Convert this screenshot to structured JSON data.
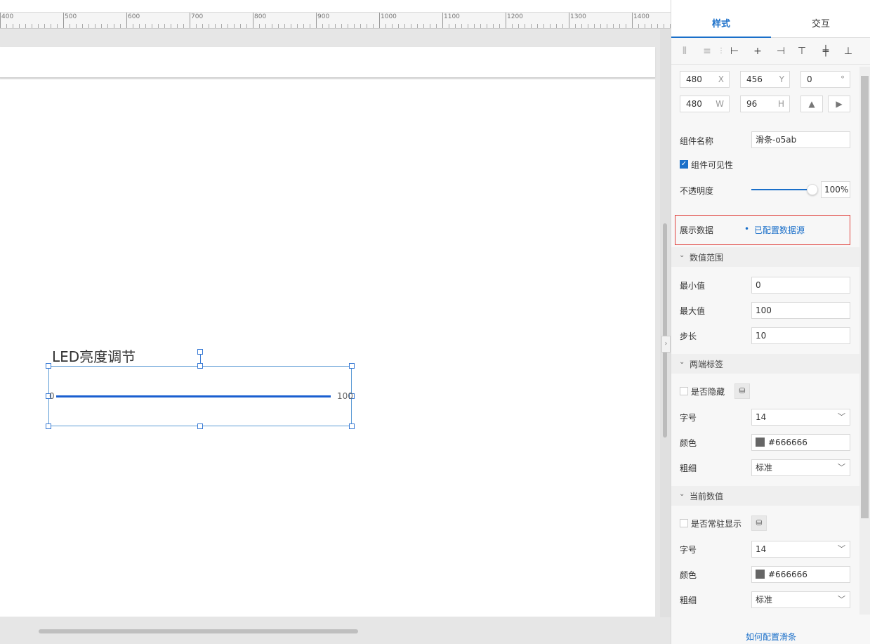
{
  "ruler": {
    "ticks": [
      "400",
      "500",
      "600",
      "700",
      "800",
      "900",
      "1000",
      "1100",
      "1200",
      "1300",
      "1400"
    ]
  },
  "canvas": {
    "widget_title": "LED亮度调节",
    "slider": {
      "min_label": "0",
      "max_label": "100"
    }
  },
  "panel": {
    "tabs": [
      {
        "label": "样式",
        "active": true
      },
      {
        "label": "交互",
        "active": false
      }
    ],
    "position": {
      "x": {
        "value": "480",
        "unit": "X"
      },
      "y": {
        "value": "456",
        "unit": "Y"
      },
      "rotate": {
        "value": "0",
        "unit": "°"
      },
      "w": {
        "value": "480",
        "unit": "W"
      },
      "h": {
        "value": "96",
        "unit": "H"
      }
    },
    "component_name": {
      "label": "组件名称",
      "value": "滑条-o5ab"
    },
    "visibility": {
      "label": "组件可见性",
      "checked": true
    },
    "opacity": {
      "label": "不透明度",
      "value": "100%",
      "level": 1.0
    },
    "data_source": {
      "label": "展示数据",
      "status": "已配置数据源"
    },
    "range_section": {
      "title": "数值范围",
      "min": {
        "label": "最小值",
        "value": "0"
      },
      "max": {
        "label": "最大值",
        "value": "100"
      },
      "step": {
        "label": "步长",
        "value": "10"
      }
    },
    "end_labels_section": {
      "title": "两端标签",
      "hide": {
        "label": "是否隐藏",
        "checked": false
      },
      "font_size": {
        "label": "字号",
        "value": "14"
      },
      "color": {
        "label": "颜色",
        "value": "#666666"
      },
      "weight": {
        "label": "粗细",
        "value": "标准"
      }
    },
    "current_value_section": {
      "title": "当前数值",
      "always_show": {
        "label": "是否常驻显示",
        "checked": false
      },
      "font_size": {
        "label": "字号",
        "value": "14"
      },
      "color": {
        "label": "颜色",
        "value": "#666666"
      },
      "weight": {
        "label": "粗细",
        "value": "标准"
      }
    },
    "help_link": "如何配置滑条"
  },
  "colors": {
    "accent": "#1a6fc9",
    "selection": "#5b9bd5",
    "highlight_border": "#e0443f",
    "slider_track": "#1a5fd0"
  }
}
